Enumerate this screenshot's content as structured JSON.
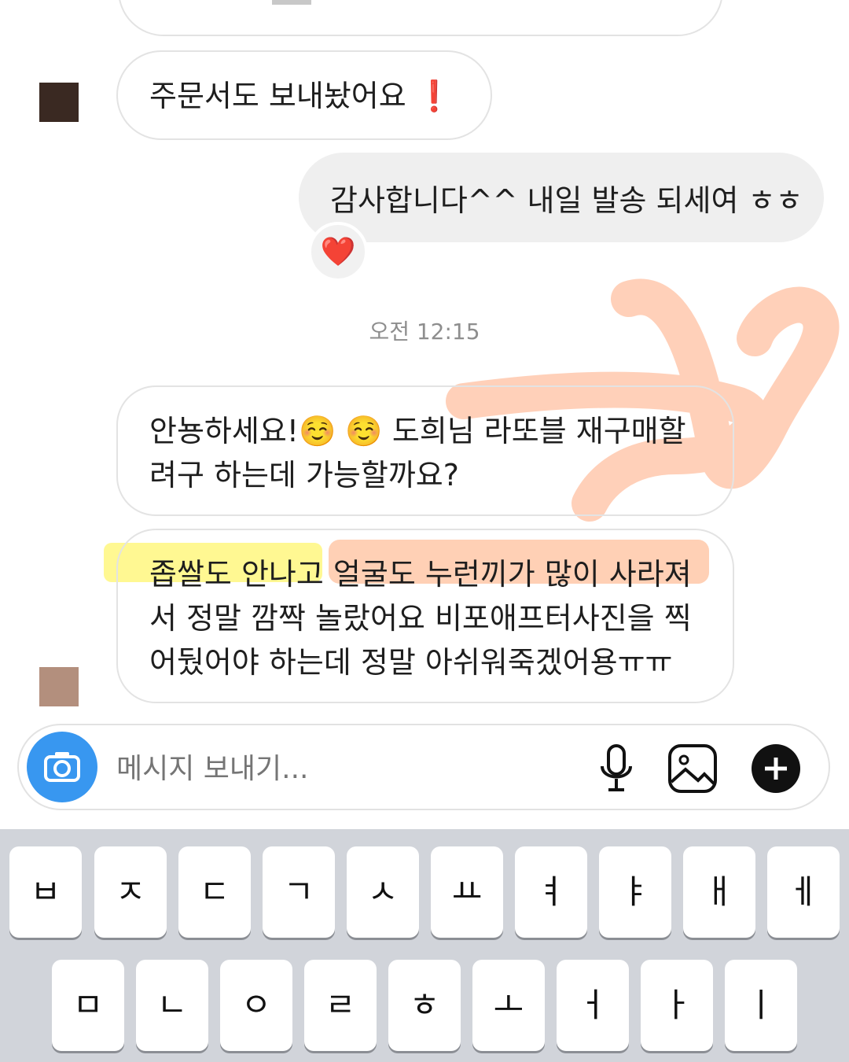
{
  "colors": {
    "accent_blue": "#3897f0",
    "highlight_yellow": "#fff66e",
    "highlight_orange": "#ffaa78",
    "heart_red": "#e5172b"
  },
  "messages": [
    {
      "side": "incoming",
      "text": "주문서도 보내놨어요",
      "emoji": "❗"
    },
    {
      "side": "outgoing",
      "text": "감사합니다^^ 내일 발송 되세여 ㅎㅎ",
      "reaction": "❤️"
    },
    {
      "side": "incoming",
      "line1": "안뇽하세요!☺️ ☺️  도희님 라또블 재구매할",
      "line2": "려구 하는데 가능할까요?"
    },
    {
      "side": "incoming",
      "line1": "좁쌀도 안나고 얼굴도 누런끼가 많이 사라져",
      "line2": "서 정말 깜짝 놀랐어요 비포애프터사진을 찍",
      "line3": "어뒀어야 하는데 정말 아쉬워죽겠어용ㅠㅠ"
    }
  ],
  "timestamp": "오전 12:15",
  "composer": {
    "placeholder": "메시지 보내기...",
    "icons": [
      "camera-icon",
      "microphone-icon",
      "gallery-icon",
      "plus-icon"
    ]
  },
  "keyboard": {
    "row1": [
      "ㅂ",
      "ㅈ",
      "ㄷ",
      "ㄱ",
      "ㅅ",
      "ㅛ",
      "ㅕ",
      "ㅑ",
      "ㅐ",
      "ㅔ"
    ],
    "row2": [
      "ㅁ",
      "ㄴ",
      "ㅇ",
      "ㄹ",
      "ㅎ",
      "ㅗ",
      "ㅓ",
      "ㅏ",
      "ㅣ"
    ]
  }
}
